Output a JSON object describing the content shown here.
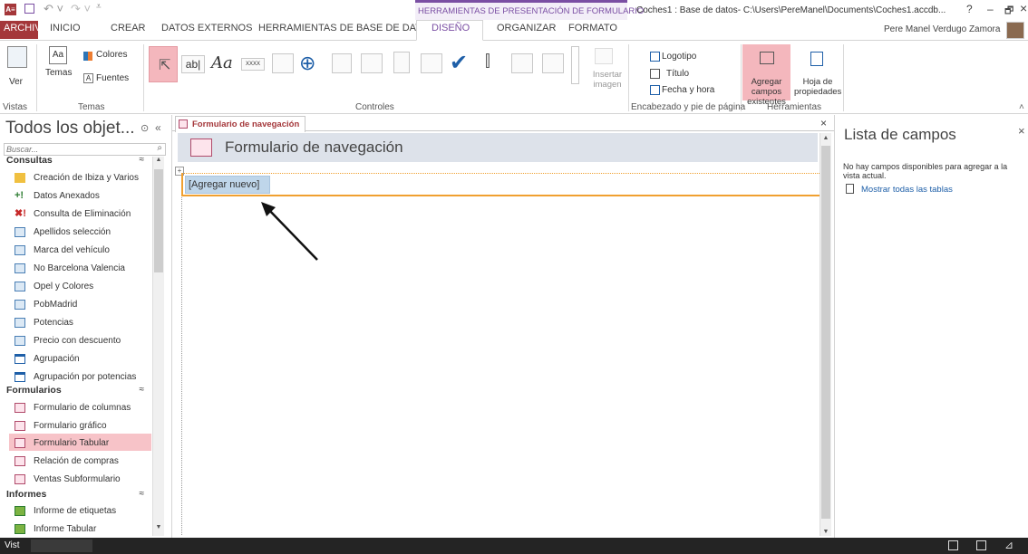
{
  "titlebar": {
    "context_group": "HERRAMIENTAS DE PRESENTACIÓN DE FORMULARIO",
    "doc_title": "Coches1 : Base de datos- C:\\Users\\PereManel\\Documents\\Coches1.accdb...",
    "help": "?",
    "minimize": "–",
    "restore": "🗗",
    "close": "×"
  },
  "tabs": {
    "archivo": "ARCHIVO",
    "inicio": "INICIO",
    "crear": "CREAR",
    "datos_externos": "DATOS EXTERNOS",
    "herramientas_bd": "HERRAMIENTAS DE BASE DE DATOS",
    "diseno": "DISEÑO",
    "organizar": "ORGANIZAR",
    "formato": "FORMATO",
    "user": "Pere Manel Verdugo Zamora"
  },
  "ribbon": {
    "ver": "Ver",
    "temas": "Temas",
    "colores": "Colores",
    "fuentes": "Fuentes",
    "insertar_imagen": "Insertar imagen",
    "logotipo": "Logotipo",
    "titulo": "Título",
    "fecha_hora": "Fecha y hora",
    "agregar_campos": "Agregar campos existentes",
    "hoja_propiedades": "Hoja de propiedades",
    "groups": {
      "vistas": "Vistas",
      "temas": "Temas",
      "controles": "Controles",
      "encabezado": "Encabezado y pie de página",
      "herramientas": "Herramientas"
    },
    "aa_label": "Aa",
    "ab_label": "ab|",
    "xxxx": "XXXX"
  },
  "nav": {
    "title": "Todos los objet...",
    "search_placeholder": "Buscar...",
    "sections": [
      {
        "label": "Consultas"
      },
      {
        "label": "Formularios"
      },
      {
        "label": "Informes"
      }
    ],
    "consultas": [
      "Creación de Ibiza y Varios",
      "Datos Anexados",
      "Consulta de Eliminación",
      "Apellidos selección",
      "Marca del vehículo",
      "No Barcelona Valencia",
      "Opel y Colores",
      "PobMadrid",
      "Potencias",
      "Precio con descuento",
      "Agrupación",
      "Agrupación por potencias"
    ],
    "formularios": [
      "Formulario de columnas",
      "Formulario gráfico",
      "Formulario Tabular",
      "Relación de compras",
      "Ventas Subformulario"
    ],
    "informes": [
      "Informe de etiquetas",
      "Informe Tabular"
    ]
  },
  "doc": {
    "tab_label": "Formulario de navegación",
    "header_title": "Formulario de navegación",
    "add_new": "[Agregar nuevo]"
  },
  "fieldlist": {
    "title": "Lista de campos",
    "message": "No hay campos disponibles para agregar a la vista actual.",
    "show_all": "Mostrar todas las tablas"
  },
  "statusbar": {
    "left": "Vist"
  },
  "colors": {
    "accent": "#a4373a",
    "context": "#7a4ea3",
    "selected": "#f4b7bd",
    "statusbar": "#242424",
    "nav_selected": "#f7c3c8"
  }
}
